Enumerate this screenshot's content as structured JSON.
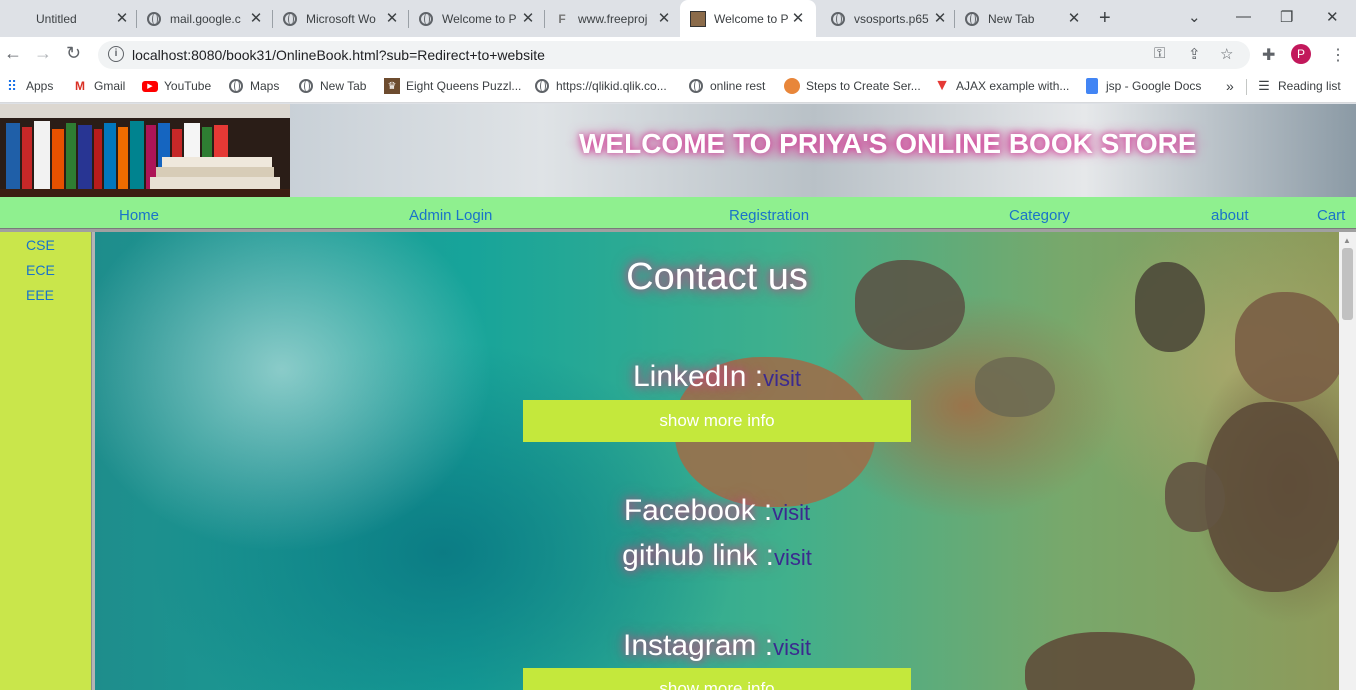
{
  "browser": {
    "tabs": [
      {
        "title": "Untitled",
        "icon": "blank-tab-icon",
        "active": false
      },
      {
        "title": "mail.google.c",
        "icon": "globe-icon",
        "active": false
      },
      {
        "title": "Microsoft Wo",
        "icon": "globe-icon",
        "active": false
      },
      {
        "title": "Welcome to P",
        "icon": "globe-icon",
        "active": false
      },
      {
        "title": "www.freeproj",
        "icon": "freeprojects-icon",
        "active": false
      },
      {
        "title": "Welcome to P",
        "icon": "bookstore-icon",
        "active": true
      },
      {
        "title": "vsosports.p65",
        "icon": "globe-icon",
        "active": false
      },
      {
        "title": "New Tab",
        "icon": "chrome-icon",
        "active": false
      }
    ],
    "new_tab_symbol": "+",
    "url": "localhost:8080/book31/OnlineBook.html?sub=Redirect+to+website",
    "profile_initial": "P",
    "bookmarks": [
      {
        "label": "Apps",
        "icon": "apps-grid-icon"
      },
      {
        "label": "Gmail",
        "icon": "gmail-icon"
      },
      {
        "label": "YouTube",
        "icon": "youtube-icon"
      },
      {
        "label": "Maps",
        "icon": "globe-icon"
      },
      {
        "label": "New Tab",
        "icon": "globe-icon"
      },
      {
        "label": "Eight Queens Puzzl...",
        "icon": "chess-icon"
      },
      {
        "label": "https://qlikid.qlik.co...",
        "icon": "globe-icon"
      },
      {
        "label": "online rest",
        "icon": "globe-icon"
      },
      {
        "label": "Steps to Create Ser...",
        "icon": "tutorial-icon"
      },
      {
        "label": "AJAX example with...",
        "icon": "red-v-icon"
      },
      {
        "label": "jsp - Google Docs",
        "icon": "google-docs-icon"
      }
    ],
    "bookmarks_overflow": "»",
    "reading_list": "Reading list"
  },
  "site": {
    "banner_title": "WELCOME TO PRIYA'S ONLINE BOOK STORE",
    "nav": [
      "Home",
      "Admin Login",
      "Registration",
      "Category",
      "about",
      "Cart"
    ],
    "categories": [
      "CSE",
      "ECE",
      "EEE"
    ],
    "contact": {
      "title": "Contact us",
      "entries": [
        {
          "label": "LinkedIn :",
          "link": "visit"
        },
        {
          "label": "Facebook :",
          "link": "visit"
        },
        {
          "label": "github link :",
          "link": "visit"
        },
        {
          "label": "Instagram :",
          "link": "visit"
        }
      ],
      "more_button": "show more info"
    }
  },
  "colors": {
    "nav_bar": "#8ff08f",
    "sidebar": "#c9e64b",
    "more_button": "#c4e83c",
    "link": "#1a73c9",
    "visit_link": "#3b2a8f",
    "glow": "#c2477f"
  }
}
